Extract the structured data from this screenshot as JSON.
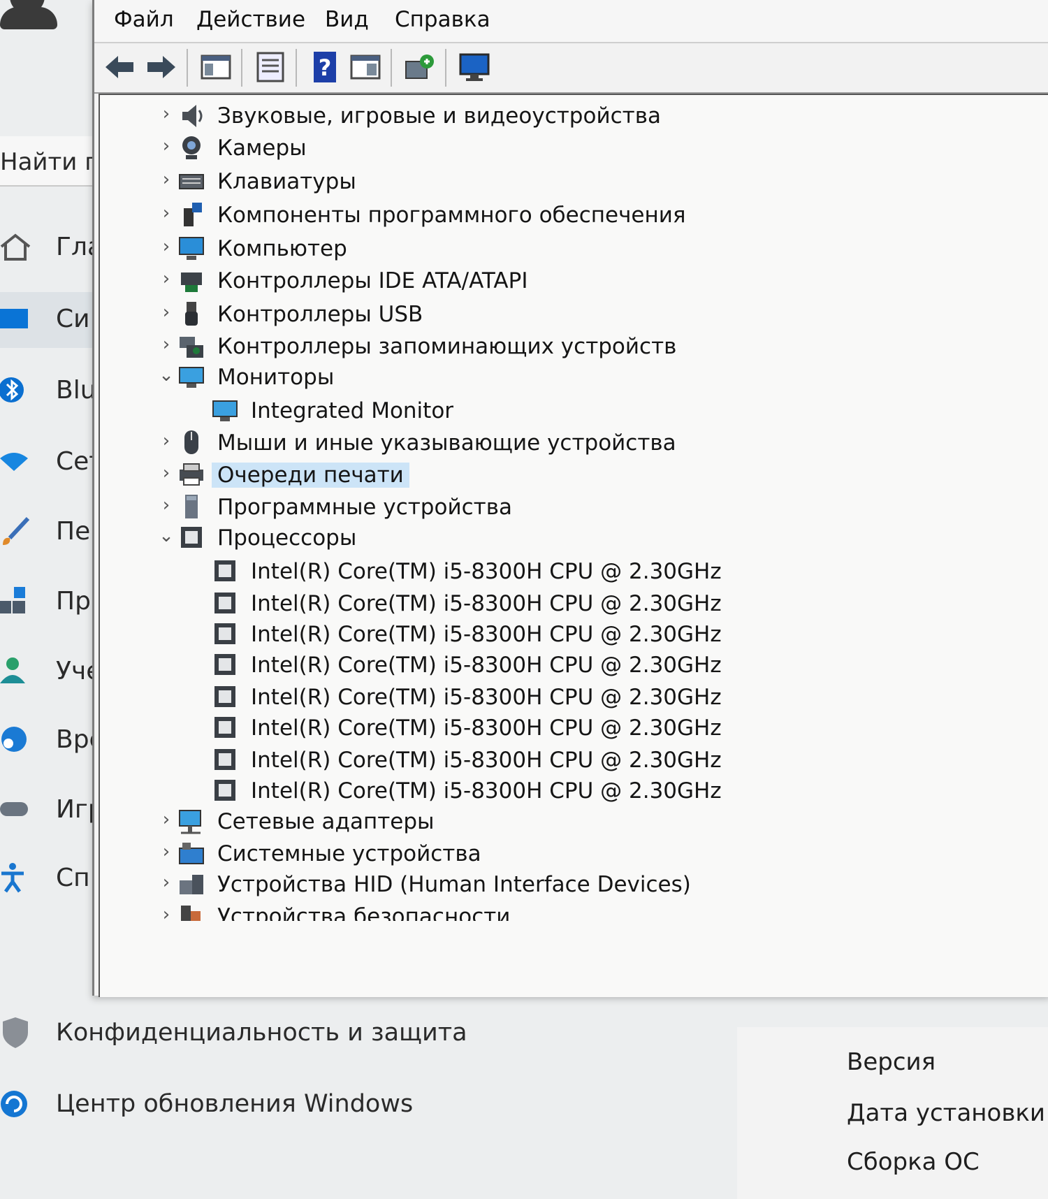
{
  "menu": [
    "Файл",
    "Действие",
    "Вид",
    "Справка"
  ],
  "toolbar_icons": [
    "back-arrow-icon",
    "forward-arrow-icon",
    "show-hide-console-tree-icon",
    "properties-icon",
    "help-icon",
    "show-action-pane-icon",
    "scan-hardware-icon",
    "monitor-icon"
  ],
  "tree": [
    {
      "label": "Звуковые, игровые и видеоустройства",
      "icon": "speaker-icon",
      "level": 0,
      "expanded": false
    },
    {
      "label": "Камеры",
      "icon": "camera-icon",
      "level": 0,
      "expanded": false
    },
    {
      "label": "Клавиатуры",
      "icon": "keyboard-icon",
      "level": 0,
      "expanded": false
    },
    {
      "label": "Компоненты программного обеспечения",
      "icon": "software-component-icon",
      "level": 0,
      "expanded": false
    },
    {
      "label": "Компьютер",
      "icon": "computer-icon",
      "level": 0,
      "expanded": false
    },
    {
      "label": "Контроллеры IDE ATA/ATAPI",
      "icon": "ide-controller-icon",
      "level": 0,
      "expanded": false
    },
    {
      "label": "Контроллеры USB",
      "icon": "usb-icon",
      "level": 0,
      "expanded": false
    },
    {
      "label": "Контроллеры запоминающих устройств",
      "icon": "storage-controller-icon",
      "level": 0,
      "expanded": false
    },
    {
      "label": "Мониторы",
      "icon": "monitor-icon",
      "level": 0,
      "expanded": true
    },
    {
      "label": "Integrated Monitor",
      "icon": "monitor-icon",
      "level": 1
    },
    {
      "label": "Мыши и иные указывающие устройства",
      "icon": "mouse-icon",
      "level": 0,
      "expanded": false
    },
    {
      "label": "Очереди печати",
      "icon": "printer-icon",
      "level": 0,
      "expanded": false,
      "selected": true
    },
    {
      "label": "Программные устройства",
      "icon": "software-device-icon",
      "level": 0,
      "expanded": false
    },
    {
      "label": "Процессоры",
      "icon": "processor-icon",
      "level": 0,
      "expanded": true
    },
    {
      "label": "Intel(R) Core(TM) i5-8300H CPU @ 2.30GHz",
      "icon": "processor-icon",
      "level": 1
    },
    {
      "label": "Intel(R) Core(TM) i5-8300H CPU @ 2.30GHz",
      "icon": "processor-icon",
      "level": 1
    },
    {
      "label": "Intel(R) Core(TM) i5-8300H CPU @ 2.30GHz",
      "icon": "processor-icon",
      "level": 1
    },
    {
      "label": "Intel(R) Core(TM) i5-8300H CPU @ 2.30GHz",
      "icon": "processor-icon",
      "level": 1
    },
    {
      "label": "Intel(R) Core(TM) i5-8300H CPU @ 2.30GHz",
      "icon": "processor-icon",
      "level": 1
    },
    {
      "label": "Intel(R) Core(TM) i5-8300H CPU @ 2.30GHz",
      "icon": "processor-icon",
      "level": 1
    },
    {
      "label": "Intel(R) Core(TM) i5-8300H CPU @ 2.30GHz",
      "icon": "processor-icon",
      "level": 1
    },
    {
      "label": "Intel(R) Core(TM) i5-8300H CPU @ 2.30GHz",
      "icon": "processor-icon",
      "level": 1
    },
    {
      "label": "Сетевые адаптеры",
      "icon": "network-adapter-icon",
      "level": 0,
      "expanded": false
    },
    {
      "label": "Системные устройства",
      "icon": "system-devices-icon",
      "level": 0,
      "expanded": false
    },
    {
      "label": "Устройства HID (Human Interface Devices)",
      "icon": "hid-icon",
      "level": 0,
      "expanded": false
    },
    {
      "label": "Устройства безопасности",
      "icon": "security-devices-icon",
      "level": 0,
      "expanded": false,
      "cut": true
    }
  ],
  "settings": {
    "search_placeholder": "Найти п",
    "nav": [
      {
        "label": "Гла",
        "icon": "home-icon"
      },
      {
        "label": "Си",
        "icon": "system-icon",
        "selected": true
      },
      {
        "label": "Blu",
        "icon": "bluetooth-icon"
      },
      {
        "label": "Сет",
        "icon": "network-icon"
      },
      {
        "label": "Пе",
        "icon": "personalization-brush-icon"
      },
      {
        "label": "Пр",
        "icon": "apps-icon"
      },
      {
        "label": "Уче",
        "icon": "accounts-icon"
      },
      {
        "label": "Вре",
        "icon": "time-language-icon"
      },
      {
        "label": "Игр",
        "icon": "gaming-icon"
      },
      {
        "label": "Сп",
        "icon": "accessibility-icon"
      }
    ],
    "privacy_label": "Конфиденциальность и защита",
    "update_label": "Центр обновления Windows",
    "info_labels": [
      "Версия",
      "Дата установки",
      "Сборка ОС"
    ]
  },
  "colors": {
    "accent": "#0067c0",
    "selection": "#cce4f7"
  }
}
